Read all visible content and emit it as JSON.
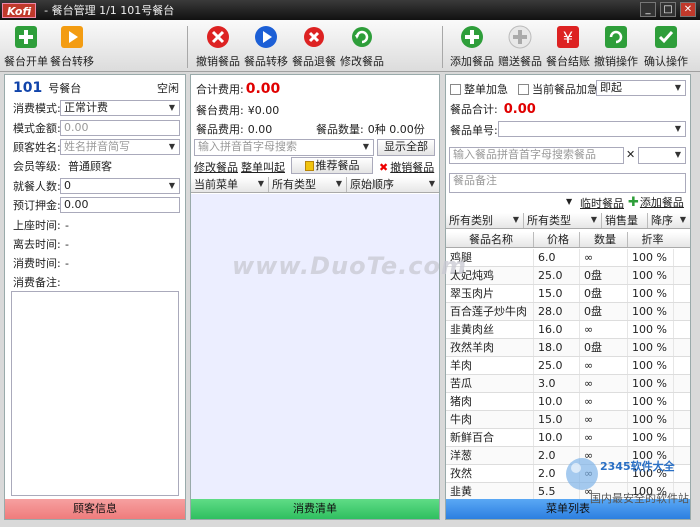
{
  "app": {
    "logo": "Kofi",
    "title": "- 餐台管理 1/1 101号餐台"
  },
  "toolbar": {
    "open_table": "餐台开单",
    "transfer_table": "餐台转移",
    "cancel_item": "撤销餐品",
    "transfer_item": "餐品转移",
    "return_item": "餐品退餐",
    "modify_item": "修改餐品",
    "add_item": "添加餐品",
    "gift_item": "赠送餐品",
    "checkout": "餐台结账",
    "undo": "撤销操作",
    "confirm": "确认操作"
  },
  "left": {
    "table_no": "101",
    "table_name": "号餐台",
    "status": "空闲",
    "consume_mode_label": "消费模式:",
    "consume_mode": "正常计费",
    "template_amount_label": "模式金额:",
    "template_amount": "0.00",
    "customer_name_label": "顾客姓名:",
    "customer_name_ph": "姓名拼音简写",
    "member_level_label": "会员等级:",
    "member_level": "普通顾客",
    "diners_label": "就餐人数:",
    "diners": "0",
    "deposit_label": "预订押金:",
    "deposit": "0.00",
    "seat_time_label": "上座时间:",
    "seat_time": "-",
    "leave_time_label": "离去时间:",
    "leave_time": "-",
    "consume_time_label": "消费时间:",
    "consume_time": "-",
    "notes_label": "消费备注:",
    "footer": "顾客信息"
  },
  "middle": {
    "total_label": "合计费用:",
    "total": "0.00",
    "table_fee_label": "餐台费用:",
    "table_fee": "¥0.00",
    "item_fee_label": "餐品费用:",
    "item_fee": "0.00",
    "item_count_label": "餐品数量:",
    "item_count": "0种 0.00份",
    "search_ph": "输入拼音首字母搜索",
    "show_all": "显示全部",
    "modify_item": "修改餐品",
    "call_all": "整单叫起",
    "recommend": "推荐餐品",
    "cancel_item": "撤销餐品",
    "col1": "当前菜单",
    "col2": "所有类型",
    "col3": "原始顺序",
    "footer": "消费清单"
  },
  "right": {
    "whole_add": "整单加急",
    "current_add": "当前餐品加急",
    "timing": "即起",
    "subtotal_label": "餐品合计:",
    "subtotal": "0.00",
    "order_no_label": "餐品单号:",
    "search_ph": "输入餐品拼音首字母搜索餐品",
    "notes_ph": "餐品备注",
    "temp_item": "临时餐品",
    "add_item": "添加餐品",
    "filter1": "所有类别",
    "filter2": "所有类型",
    "filter3": "销售量",
    "filter4": "降序",
    "head_name": "餐品名称",
    "head_price": "价格",
    "head_qty": "数量",
    "head_disc": "折率",
    "footer": "菜单列表",
    "items": [
      {
        "name": "鸡腿",
        "price": "6.0",
        "qty": "∞",
        "disc": "100 %"
      },
      {
        "name": "太妃炖鸡",
        "price": "25.0",
        "qty": "0盘",
        "disc": "100 %"
      },
      {
        "name": "翠玉肉片",
        "price": "15.0",
        "qty": "0盘",
        "disc": "100 %"
      },
      {
        "name": "百合莲子炒牛肉",
        "price": "28.0",
        "qty": "0盘",
        "disc": "100 %"
      },
      {
        "name": "韭黄肉丝",
        "price": "16.0",
        "qty": "∞",
        "disc": "100 %"
      },
      {
        "name": "孜然羊肉",
        "price": "18.0",
        "qty": "0盘",
        "disc": "100 %"
      },
      {
        "name": "羊肉",
        "price": "25.0",
        "qty": "∞",
        "disc": "100 %"
      },
      {
        "name": "苦瓜",
        "price": "3.0",
        "qty": "∞",
        "disc": "100 %"
      },
      {
        "name": "猪肉",
        "price": "10.0",
        "qty": "∞",
        "disc": "100 %"
      },
      {
        "name": "牛肉",
        "price": "15.0",
        "qty": "∞",
        "disc": "100 %"
      },
      {
        "name": "新鲜百合",
        "price": "10.0",
        "qty": "∞",
        "disc": "100 %"
      },
      {
        "name": "洋葱",
        "price": "2.0",
        "qty": "∞",
        "disc": "100 %"
      },
      {
        "name": "孜然",
        "price": "2.0",
        "qty": "∞",
        "disc": "100 %"
      },
      {
        "name": "韭黄",
        "price": "5.5",
        "qty": "∞",
        "disc": "100 %"
      }
    ]
  },
  "watermark": "www.DuoTe.com",
  "corner_watermark": "2345软件大全",
  "corner_tagline": "国内最安全的软件站",
  "colors": {
    "accent_red": "#e00000",
    "footer_red": "#f08080",
    "footer_green": "#3cc86a",
    "footer_blue": "#3d8fe8"
  }
}
